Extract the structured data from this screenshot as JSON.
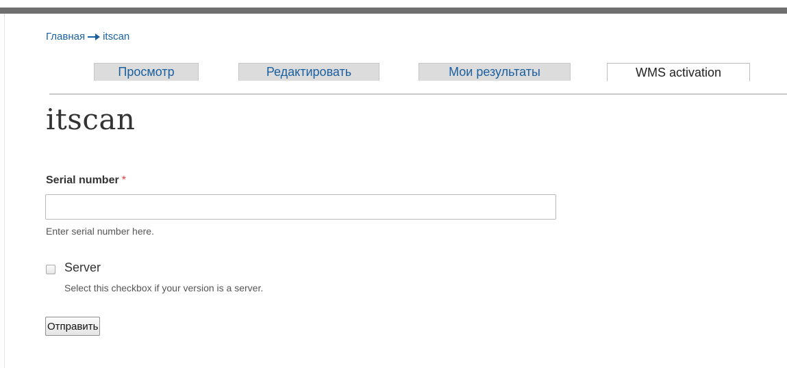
{
  "breadcrumb": {
    "home": "Главная",
    "current": "itscan"
  },
  "tabs": [
    {
      "label": "Просмотр",
      "active": false
    },
    {
      "label": "Редактировать",
      "active": false
    },
    {
      "label": "Мои результаты",
      "active": false
    },
    {
      "label": "WMS activation",
      "active": true
    }
  ],
  "page": {
    "title": "itscan"
  },
  "form": {
    "serial": {
      "label": "Serial number",
      "required_mark": "*",
      "value": "",
      "description": "Enter serial number here."
    },
    "server": {
      "label": "Server",
      "checked": false,
      "description": "Select this checkbox if your version is a server."
    },
    "submit_label": "Отправить"
  },
  "colors": {
    "link": "#1a5f9f",
    "required": "#e23a3a",
    "top_bar": "#6f6f6f",
    "tab_inactive_bg": "#dcdcdc"
  },
  "icons": {
    "breadcrumb_separator": "arrow-right-icon"
  }
}
